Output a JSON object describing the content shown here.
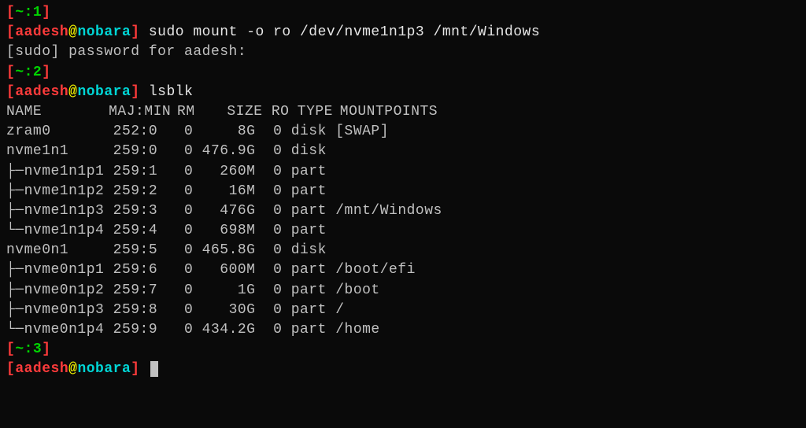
{
  "blocks": [
    {
      "cmdnum": "~:1",
      "user": "aadesh",
      "host": "nobara",
      "command": "sudo mount -o ro /dev/nvme1n1p3 /mnt/Windows",
      "after": "[sudo] password for aadesh:"
    },
    {
      "cmdnum": "~:2",
      "user": "aadesh",
      "host": "nobara",
      "command": "lsblk"
    }
  ],
  "lsblk": {
    "header": [
      "NAME",
      "MAJ:MIN",
      "RM",
      "SIZE",
      "RO",
      "TYPE",
      "MOUNTPOINTS"
    ],
    "rows": [
      {
        "tree": "",
        "name": "zram0",
        "majmin": "252:0",
        "rm": "0",
        "size": "8G",
        "ro": "0",
        "type": "disk",
        "mount": "[SWAP]"
      },
      {
        "tree": "",
        "name": "nvme1n1",
        "majmin": "259:0",
        "rm": "0",
        "size": "476.9G",
        "ro": "0",
        "type": "disk",
        "mount": ""
      },
      {
        "tree": "├─",
        "name": "nvme1n1p1",
        "majmin": "259:1",
        "rm": "0",
        "size": "260M",
        "ro": "0",
        "type": "part",
        "mount": ""
      },
      {
        "tree": "├─",
        "name": "nvme1n1p2",
        "majmin": "259:2",
        "rm": "0",
        "size": "16M",
        "ro": "0",
        "type": "part",
        "mount": ""
      },
      {
        "tree": "├─",
        "name": "nvme1n1p3",
        "majmin": "259:3",
        "rm": "0",
        "size": "476G",
        "ro": "0",
        "type": "part",
        "mount": "/mnt/Windows"
      },
      {
        "tree": "└─",
        "name": "nvme1n1p4",
        "majmin": "259:4",
        "rm": "0",
        "size": "698M",
        "ro": "0",
        "type": "part",
        "mount": ""
      },
      {
        "tree": "",
        "name": "nvme0n1",
        "majmin": "259:5",
        "rm": "0",
        "size": "465.8G",
        "ro": "0",
        "type": "disk",
        "mount": ""
      },
      {
        "tree": "├─",
        "name": "nvme0n1p1",
        "majmin": "259:6",
        "rm": "0",
        "size": "600M",
        "ro": "0",
        "type": "part",
        "mount": "/boot/efi"
      },
      {
        "tree": "├─",
        "name": "nvme0n1p2",
        "majmin": "259:7",
        "rm": "0",
        "size": "1G",
        "ro": "0",
        "type": "part",
        "mount": "/boot"
      },
      {
        "tree": "├─",
        "name": "nvme0n1p3",
        "majmin": "259:8",
        "rm": "0",
        "size": "30G",
        "ro": "0",
        "type": "part",
        "mount": "/"
      },
      {
        "tree": "└─",
        "name": "nvme0n1p4",
        "majmin": "259:9",
        "rm": "0",
        "size": "434.2G",
        "ro": "0",
        "type": "part",
        "mount": "/home"
      }
    ]
  },
  "last_prompt": {
    "cmdnum": "~:3",
    "user": "aadesh",
    "host": "nobara"
  }
}
